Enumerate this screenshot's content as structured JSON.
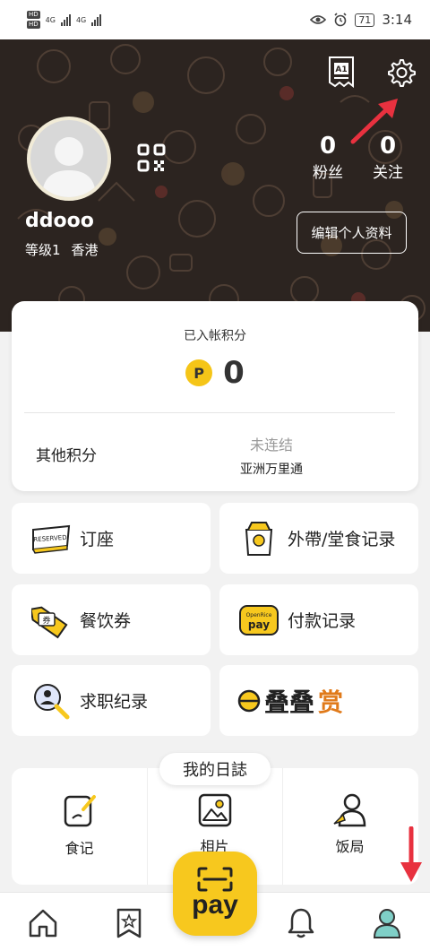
{
  "status_bar": {
    "time": "3:14",
    "battery": "71",
    "network_left": "HD",
    "network_left2": "HD",
    "signal_label1": "4G",
    "signal_label2": "4G"
  },
  "profile": {
    "username": "ddooo",
    "level": "等级1",
    "region": "香港",
    "followers_count": "0",
    "followers_label": "粉丝",
    "following_count": "0",
    "following_label": "关注",
    "edit_label": "编辑个人资料",
    "receipt_badge": "A1"
  },
  "points": {
    "label": "已入帐积分",
    "badge": "P",
    "value": "0",
    "other_label": "其他积分",
    "status": "未连结",
    "partner": "亚洲万里通"
  },
  "menu": {
    "reservation": "订座",
    "takeaway_records": "外帶/堂食记录",
    "coupons": "餐饮券",
    "payment_records": "付款记录",
    "job_records": "求职纪录",
    "brand_main": "叠叠",
    "brand_accent": "赏"
  },
  "journal": {
    "title": "我的日誌",
    "items": [
      "食记",
      "相片",
      "饭局"
    ]
  },
  "nav": {
    "pay_label": "pay"
  },
  "colors": {
    "accent": "#f7c81e",
    "header_bg": "#2c2420",
    "annotation": "#e8313f",
    "brand_accent": "#e07a1a"
  }
}
